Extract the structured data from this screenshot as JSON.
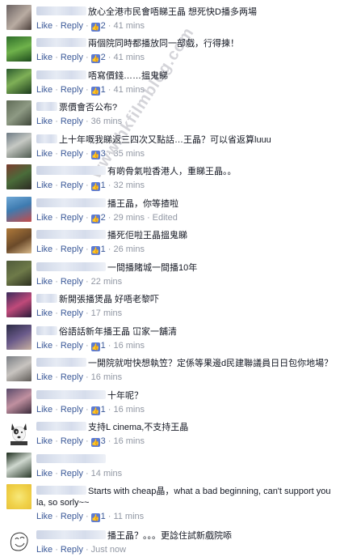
{
  "actions": {
    "like": "Like",
    "reply": "Reply"
  },
  "comments": [
    {
      "text": "放心全港市民會唔睇王晶 想死快D播多两場",
      "likes": "2",
      "time": "41 mins",
      "avatar": "user-avatar"
    },
    {
      "text": "兩個院同時都播放同一部戲，行得揀！",
      "likes": "2",
      "time": "41 mins",
      "avatar": "user-avatar"
    },
    {
      "text": "唔寫價錢……搵鬼睇",
      "likes": "1",
      "time": "41 mins",
      "avatar": "user-avatar"
    },
    {
      "text": "票價會否公布?",
      "likes": "",
      "time": "36 mins",
      "avatar": "user-avatar"
    },
    {
      "text": "上十年嘅我睇返三四次又點話…王晶？可以省返算luuu",
      "likes": "3",
      "time": "35 mins",
      "avatar": "user-avatar"
    },
    {
      "text": "有啲骨氣啦香港人，重睇王晶。。",
      "likes": "1",
      "time": "32 mins",
      "avatar": "user-avatar"
    },
    {
      "text": "播王晶，你等揸啦",
      "likes": "2",
      "time": "29 mins",
      "edited": "Edited",
      "avatar": "user-avatar"
    },
    {
      "text": "播死佢啦王晶搵鬼睇",
      "likes": "1",
      "time": "26 mins",
      "avatar": "user-avatar"
    },
    {
      "text": "一間播賭城一間播10年",
      "likes": "",
      "time": "22 mins",
      "avatar": "user-avatar"
    },
    {
      "text": "新開張播煲晶 好唔老黎吓",
      "likes": "",
      "time": "17 mins",
      "avatar": "user-avatar"
    },
    {
      "text": "俗語話新年播王晶 冚家一舖清",
      "likes": "1",
      "time": "16 mins",
      "avatar": "user-avatar"
    },
    {
      "text": "一開院就咁快想執笠？定係等果邊d民建聯議員日日包你地場？",
      "likes": "",
      "time": "16 mins",
      "avatar": "user-avatar"
    },
    {
      "text": "十年呢？",
      "likes": "1",
      "time": "16 mins",
      "avatar": "user-avatar"
    },
    {
      "text": "支持L cinema,不支持王晶",
      "likes": "3",
      "time": "16 mins",
      "avatar": "dog-avatar"
    },
    {
      "text": "",
      "likes": "",
      "time": "14 mins",
      "avatar": "user-avatar"
    },
    {
      "text": "Starts with cheap晶，what a bad beginning, can't support you la, so sorly~~",
      "likes": "1",
      "time": "11 mins",
      "avatar": "user-avatar"
    },
    {
      "text": "播王晶？。。。更諗住試新戲院㖭",
      "likes": "",
      "time": "Just now",
      "avatar": "user-avatar"
    }
  ],
  "watermark": "www.hkfilmblog.com"
}
